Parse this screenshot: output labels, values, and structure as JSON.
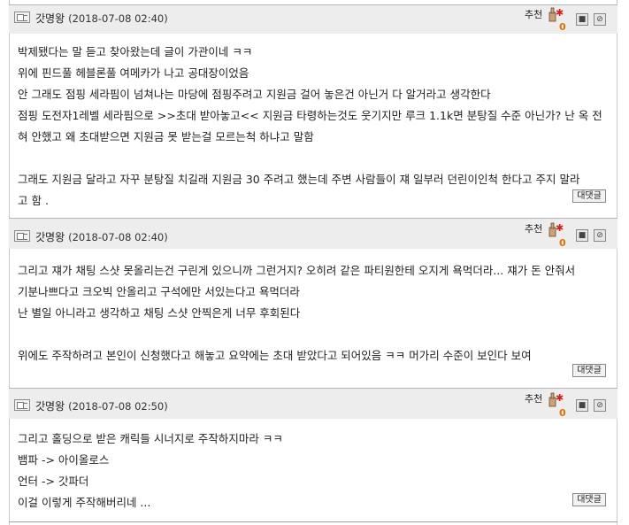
{
  "comments": [
    {
      "author": "갓명왕",
      "date": "(2018-07-08 02:40)",
      "rec_label": "추천",
      "rec_count": "0",
      "reply_label": "대댓글",
      "body": "박제됐다는 말 듣고 찾아왔는데 글이 가관이네 ㅋㅋ\n위에 핀드풀 헤블론풀 여메카가 나고 공대장이었음\n안 그래도 점핑 세라핌이 넘쳐나는 마당에 점핑주려고 지원금 걸어 놓은건 아닌거 다 알거라고 생각한다\n점핑 도전자1레벨 세라핌으로 >>초대 받아놓고<< 지원금 타령하는것도 웃기지만 루크 1.1k면 분탕질 수준 아닌가? 난 옥 전\n혀 안했고 왜 초대받으면 지원금 못 받는걸 모르는척 하냐고 말함\n\n그래도 지원금 달라고 자꾸 분탕질 치길래 지원금 30 주려고 했는데 주변 사람들이 쟤 일부러 던린이인척 한다고 주지 말라\n고 함 ."
    },
    {
      "author": "갓명왕",
      "date": "(2018-07-08 02:40)",
      "rec_label": "추천",
      "rec_count": "0",
      "reply_label": "대댓글",
      "body": "그리고 쟤가 채팅 스샷 못올리는건 구린게 있으니까 그런거지? 오히려 같은 파티원한테 오지게 욕먹더라... 쟤가 돈 안줘서\n기분나쁘다고 크오빅 안올리고 구석에만 서있는다고 욕먹더라\n난 별일 아니라고 생각하고 채팅 스샷 안찍은게 너무 후회된다\n\n위에도 주작하려고 본인이 신청했다고 해놓고 요약에는 초대 받았다고 되어있음 ㅋㅋ 머가리 수준이 보인다 보여"
    },
    {
      "author": "갓명왕",
      "date": "(2018-07-08 02:50)",
      "rec_label": "추천",
      "rec_count": "0",
      "reply_label": "대댓글",
      "body": "그리고 홀딩으로 받은 캐릭들 시너지로 주작하지마라 ㅋㅋ\n뱀파 -> 아이올로스\n언터 -> 갓파더\n이걸 이렇게 주작해버리네 ..."
    }
  ]
}
